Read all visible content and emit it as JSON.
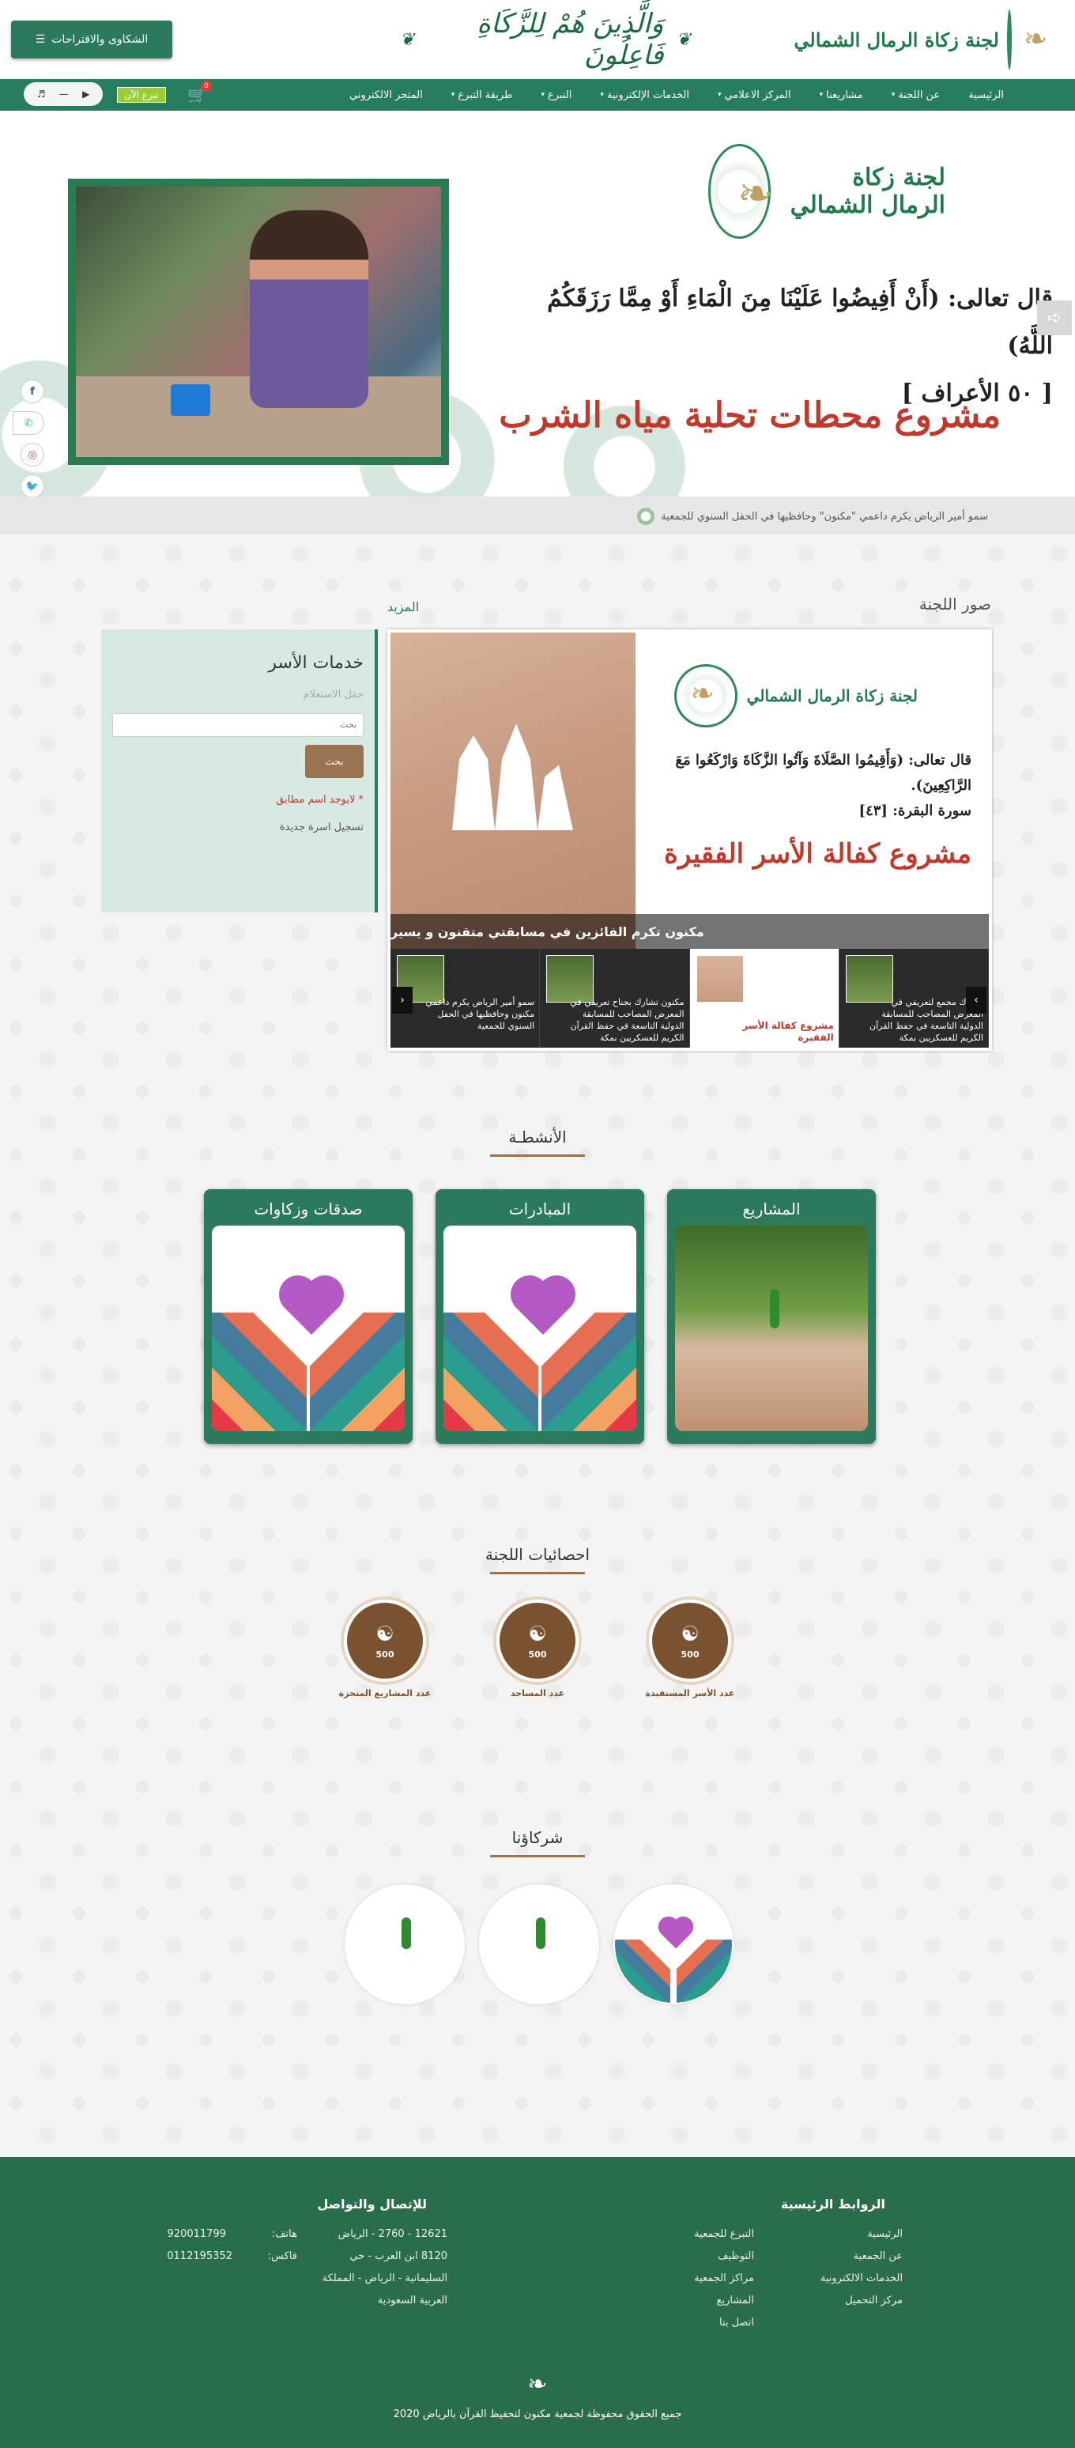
{
  "header": {
    "logo_text": "لجنة زكاة الرمال الشمالي",
    "verse_banner": "وَالَّذِينَ هُمْ لِلزَّكَاةِ فَاعِلُونَ",
    "complaints_button": "الشكاوى والاقتراحات",
    "complaints_icon": "list-icon"
  },
  "nav": {
    "items": [
      {
        "label": "الرئيسية",
        "caret": ""
      },
      {
        "label": "عن اللجنة",
        "caret": "▾"
      },
      {
        "label": "مشاريعنا",
        "caret": "▾"
      },
      {
        "label": "المركز الاعلامي",
        "caret": "▾"
      },
      {
        "label": "الخدمات الإلكترونية",
        "caret": "▾"
      },
      {
        "label": "التبرع",
        "caret": "▾"
      },
      {
        "label": "طريقة التبرع",
        "caret": "▾"
      },
      {
        "label": "المتجر الالكتروني",
        "caret": ""
      }
    ],
    "donate_now": "تبرع الآن",
    "cart_count": "0",
    "audio_controls": [
      "▶",
      "—",
      "🔊"
    ]
  },
  "hero": {
    "logo_text": "لجنة زكاة الرمال الشمالي",
    "quote_line1": "قال تعالى: (أَنْ أَفِيضُوا عَلَيْنَا مِنَ الْمَاءِ أَوْ مِمَّا رَزَقَكُمُ اللَّهُ)",
    "quote_line2": "[ ٥٠ الأعراف ]",
    "title": "مشروع محطات تحلية مياه الشرب",
    "next_arrow": "➪"
  },
  "social": {
    "facebook": "f",
    "whatsapp": "✆",
    "instagram": "◎",
    "twitter": "🐦"
  },
  "ticker": {
    "text": "سمو أمير الرياض يكرم داعمي \"مكنون\" وحافظيها في الحفل السنوي للجمعية"
  },
  "gallery": {
    "title": "صور اللجنة",
    "more": "المزيد",
    "logo_text": "لجنة زكاة الرمال الشمالي",
    "quote": "قال تعالى: (وَأَقِيمُوا الصَّلَاةَ وَآتُوا الزَّكَاةَ وَارْكَعُوا مَعَ الرَّاكِعِينَ).",
    "quote_ref": "سورة البقرة: [٤٣]",
    "project_title": "مشروع كفالة الأسر الفقيرة",
    "caption": "مكنون تكرم الفائزين في مسابقتي متقنون و يسير",
    "thumbs": [
      {
        "text": "تشارك مجمع لتعريفي في المعرض المصاحب للمسابقة الدولية التاسعة في حفظ القرآن الكريم للعسكريين بمكة"
      },
      {
        "text": "مشروع كفالة الأسر الفقيرة"
      },
      {
        "text": "مكنون تشارك بجناح تعريفي في المعرض المصاحب للمسابقة الدولية التاسعة في حفظ القرآن الكريم للعسكريين بمكة"
      },
      {
        "text": "سمو أمير الرياض يكرم داعمي مكنون وحافظيها في الحفل السنوي للجمعية"
      }
    ],
    "prev": "‹",
    "next": "›"
  },
  "services": {
    "title": "خدمات الأسر",
    "field_label": "حقل الاستعلام",
    "input_placeholder": "بحث",
    "button": "بحث",
    "error": "* لايوجد اسم مطابق",
    "register": "تسجيل اسرة جديدة"
  },
  "activities": {
    "heading": "الأنشطـة",
    "items": [
      {
        "title": "المشاريع"
      },
      {
        "title": "المبادرات"
      },
      {
        "title": "صدقات وزكاوات"
      }
    ]
  },
  "stats": {
    "heading": "احصائيات اللجنة",
    "items": [
      {
        "value": "500",
        "label": "عدد الأسر المستفيدة"
      },
      {
        "value": "500",
        "label": "عدد المساجد"
      },
      {
        "value": "500",
        "label": "عدد المشاريع المنجزة"
      }
    ],
    "icon": "group-icon"
  },
  "partners": {
    "heading": "شركاؤنا"
  },
  "footer": {
    "links_title": "الروابط الرئيسية",
    "links_col1": [
      "الرئيسية",
      "عن الجمعية",
      "الخدمات الالكترونية",
      "مركز التحميل"
    ],
    "links_col2": [
      "التبرع للجمعية",
      "التوظيف",
      "مراكز الجمعية",
      "المشاريع",
      "اتصل بنا"
    ],
    "contact_title": "للإتصال والتواصل",
    "address_lines": [
      "12621 - 2760 - الرياض",
      "8120 ابن العرب - حي",
      "السليمانية - الرياض - المملكة",
      "العربية السعودية"
    ],
    "phone_label": "هاتف:",
    "fax_label": "فاكس:",
    "phone": "920011799",
    "fax": "0112195352",
    "copyright": "جميع الحقوق محفوظة لجمعية مكنون لتحفيظ القرآن بالرياض 2020"
  }
}
